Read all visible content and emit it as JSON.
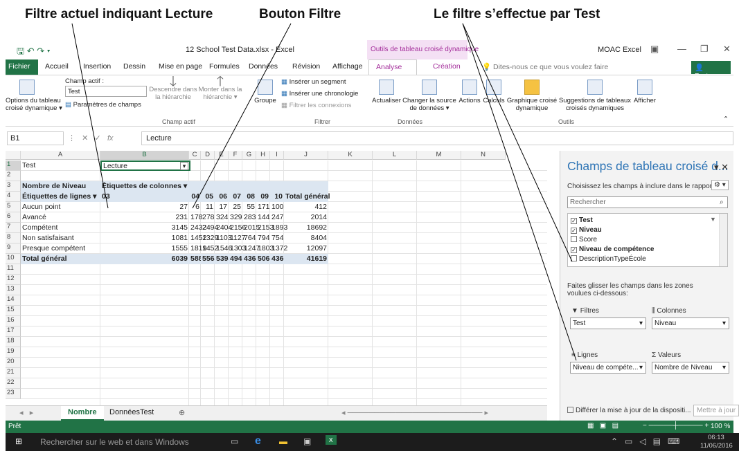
{
  "callouts": {
    "filter_label": "Filtre actuel indiquant Lecture",
    "filter_button": "Bouton Filtre",
    "filter_by_test": "Le filtre s’effectue par Test"
  },
  "titlebar": {
    "file_name": "12 School Test Data.xlsx - Excel",
    "context_title": "Outils de tableau croisé dynamique",
    "account": "MOAC Excel"
  },
  "tabs": {
    "file": "Fichier",
    "home": "Accueil",
    "insert": "Insertion",
    "draw": "Dessin",
    "layout": "Mise en page",
    "formulas": "Formules",
    "data": "Données",
    "review": "Révision",
    "view": "Affichage",
    "analyze": "Analyse",
    "design": "Création",
    "tell_me": "Dites-nous ce que vous voulez faire",
    "share": "Partager"
  },
  "ribbon": {
    "options_l1": "Options du tableau",
    "options_l2": "croisé dynamique ▾",
    "active_field_label": "Champ actif :",
    "active_field_value": "Test",
    "field_settings": "Paramètres de champs",
    "drill_down_l1": "Descendre dans",
    "drill_down_l2": "la hiérarchie",
    "drill_up_l1": "Monter dans la",
    "drill_up_l2": "hiérarchie ▾",
    "group_active_field": "Champ actif",
    "group_btn": "Groupe",
    "insert_slicer": "Insérer un segment",
    "insert_timeline": "Insérer une chronologie",
    "filter_connections": "Filtrer les connexions",
    "group_filter": "Filtrer",
    "refresh": "Actualiser",
    "change_source_l1": "Changer la source",
    "change_source_l2": "de données ▾",
    "group_data": "Données",
    "actions": "Actions",
    "calculations": "Calculs",
    "pivot_chart_l1": "Graphique croisé",
    "pivot_chart_l2": "dynamique",
    "recommended_l1": "Suggestions de tableaux",
    "recommended_l2": "croisés dynamiques",
    "group_tools": "Outils",
    "show": "Afficher"
  },
  "formula_bar": {
    "name_box": "B1",
    "content": "Lecture"
  },
  "columns": [
    "A",
    "B",
    "C",
    "D",
    "E",
    "F",
    "G",
    "H",
    "I",
    "J",
    "K",
    "L",
    "M",
    "N"
  ],
  "rows": [
    "1",
    "2",
    "3",
    "4",
    "5",
    "6",
    "7",
    "8",
    "9",
    "10",
    "11",
    "12",
    "13",
    "14",
    "15",
    "16",
    "17",
    "18",
    "19",
    "20",
    "21",
    "22",
    "23"
  ],
  "pivot": {
    "filter_field": "Test",
    "filter_value": "Lecture",
    "values_label": "Nombre de Niveau",
    "col_labels": "Étiquettes de colonnes",
    "row_labels": "Étiquettes de lignes",
    "headers": [
      "03",
      "04",
      "05",
      "06",
      "07",
      "08",
      "09",
      "10",
      "Total général"
    ],
    "data": [
      {
        "label": "Aucun point",
        "values": [
          "27",
          "6",
          "11",
          "17",
          "25",
          "55",
          "171",
          "100",
          "412"
        ]
      },
      {
        "label": "Avancé",
        "values": [
          "231",
          "178",
          "278",
          "324",
          "329",
          "283",
          "144",
          "247",
          "2014"
        ]
      },
      {
        "label": "Compétent",
        "values": [
          "3145",
          "2432",
          "2494",
          "2404",
          "2156",
          "2015",
          "2153",
          "1893",
          "18692"
        ]
      },
      {
        "label": "Non satisfaisant",
        "values": [
          "1081",
          "1452",
          "1329",
          "1103",
          "1127",
          "764",
          "794",
          "754",
          "8404"
        ]
      },
      {
        "label": "Presque compétent",
        "values": [
          "1555",
          "1819",
          "1452",
          "1546",
          "1303",
          "1247",
          "1803",
          "1372",
          "12097"
        ]
      }
    ],
    "total": {
      "label": "Total général",
      "values": [
        "6039",
        "5887",
        "5564",
        "5394",
        "4940",
        "4364",
        "5065",
        "4366",
        "41619"
      ]
    }
  },
  "sheets": {
    "active": "Nombre",
    "other": "DonnéesTest"
  },
  "pane": {
    "title": "Champs de tableau croisé d...",
    "choose": "Choisissez les champs à inclure dans le rapport :",
    "search_placeholder": "Rechercher",
    "fields": [
      {
        "name": "Test",
        "checked": true
      },
      {
        "name": "Niveau",
        "checked": true
      },
      {
        "name": "Score",
        "checked": false
      },
      {
        "name": "Niveau de compétence",
        "checked": true
      },
      {
        "name": "DescriptionTypeÉcole",
        "checked": false
      }
    ],
    "drag_hint": "Faites glisser les champs dans les zones voulues ci-dessous:",
    "filters_label": "Filtres",
    "columns_label": "Colonnes",
    "rows_label": "Lignes",
    "values_label": "Valeurs",
    "filters_value": "Test",
    "columns_value": "Niveau",
    "rows_value": "Niveau de compéte...",
    "values_value": "Nombre de Niveau",
    "defer": "Différer la mise à jour de la dispositi...",
    "update": "Mettre à jour"
  },
  "status": {
    "ready": "Prêt",
    "zoom": "100 %"
  },
  "taskbar": {
    "search": "Rechercher sur le web et dans Windows",
    "time": "06:13",
    "date": "11/06/2016"
  }
}
